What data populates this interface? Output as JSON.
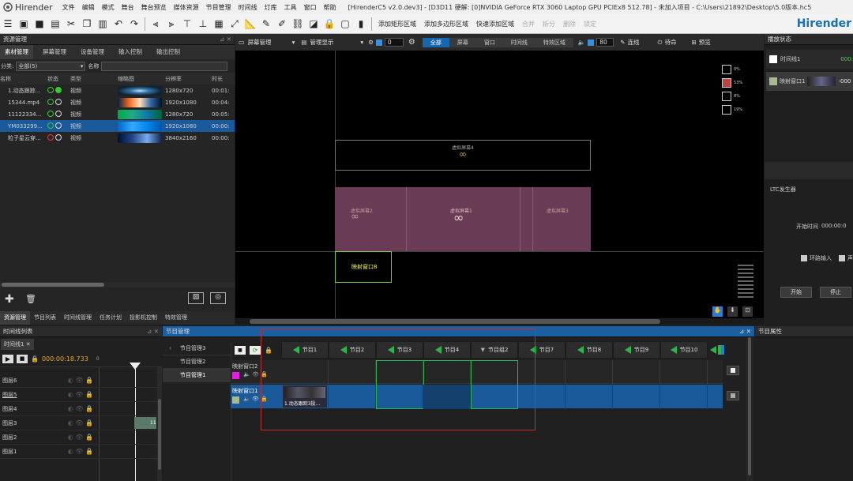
{
  "app": {
    "name": "Hirender",
    "brand": "Hirender"
  },
  "menu": [
    "文件",
    "编辑",
    "模式",
    "舞台",
    "舞台预览",
    "媒体资源",
    "节目管理",
    "时间线",
    "灯库",
    "工具",
    "窗口",
    "帮助"
  ],
  "window_title": "[HirenderC5 v2.0.dev3] - [D3D11 硬解: [0]NVIDIA GeForce RTX 3060 Laptop GPU PCIEx8 512.78] - 未加入项目 - C:\\Users\\21892\\Desktop\\5.0版本.hc5",
  "toolbar": {
    "add_rect_area": "添加矩形区域",
    "add_poly_area": "添加多边形区域",
    "quick_add_area": "快速添加区域",
    "merge": "合并",
    "split": "拆分",
    "delete": "删除",
    "lock": "锁定"
  },
  "resource_panel": {
    "title": "资源管理",
    "tabs": [
      "素材管理",
      "屏幕管理",
      "设备管理",
      "输入控制",
      "输出控制"
    ],
    "category_label": "分类:",
    "category_value": "全部(5)",
    "name_label": "名称",
    "columns": [
      "名称",
      "状态",
      "类型",
      "缩略图",
      "分辨率",
      "时长"
    ],
    "rows": [
      {
        "name": "1.动态跟踪...",
        "type": "视频",
        "res": "1280x720",
        "dur": "00:01:",
        "status": "green"
      },
      {
        "name": "15344.mp4",
        "type": "视频",
        "res": "1920x1080",
        "dur": "00:04:",
        "status": "green"
      },
      {
        "name": "11122334...",
        "type": "视频",
        "res": "1280x720",
        "dur": "00:05:",
        "status": "green"
      },
      {
        "name": "YM033299...",
        "type": "视频",
        "res": "1920x1080",
        "dur": "00:00:",
        "status": "green",
        "selected": true
      },
      {
        "name": "粒子星云穿...",
        "type": "视频",
        "res": "3840x2160",
        "dur": "00:00:",
        "status": "red"
      }
    ],
    "bottom_tabs": [
      "资源管理",
      "节目列表",
      "时间线管理",
      "任务计划",
      "投影机控制",
      "特效管理"
    ]
  },
  "view_toolbar": {
    "screen_manage": "屏幕管理",
    "manage_display": "管理显示",
    "value1": "0",
    "segments": [
      "全部",
      "屏幕",
      "窗口",
      "时间线",
      "特效区域"
    ],
    "value2": "80",
    "connect": "连线",
    "standby": "待命",
    "preview": "预览"
  },
  "stage": {
    "screen4": "虚拟屏幕4",
    "screen2": "虚拟屏幕2",
    "screen1": "虚拟屏幕1",
    "screen3": "虚拟屏幕3",
    "window": "映射窗口8",
    "stats": [
      "0%",
      "53%",
      "8%",
      "19%"
    ]
  },
  "play_state": {
    "title": "播放状态",
    "timeline": "时间线1",
    "timeline_val": "000:",
    "window": "映射窗口1",
    "window_val": "-000",
    "ltc_title": "LTC发生器",
    "start_time_label": "开始时间",
    "start_time": "000:00:0",
    "loop_label": "环路输入",
    "sound_label": "声",
    "start_btn": "开始",
    "stop_btn": "停止"
  },
  "timeline_panel": {
    "title": "时间线列表",
    "tab": "时间线1",
    "time": "000:00:18.733",
    "tick": "0",
    "clip_label": "11",
    "layers": [
      "图层6",
      "图层5",
      "图层4",
      "图层3",
      "图层2",
      "图层1"
    ]
  },
  "program_panel": {
    "title": "节目管理",
    "groups": [
      "节目管理3",
      "节目管理2",
      "节目管理1"
    ],
    "headers": [
      "节目1",
      "节目2",
      "节目3",
      "节目4",
      "节目组2",
      "节目7",
      "节目8",
      "节目9",
      "节目10"
    ],
    "windows": [
      "映射窗口2",
      "映射窗口1"
    ],
    "clip": "1.动态跟踪3投..."
  },
  "program_props": {
    "title": "节目属性"
  }
}
